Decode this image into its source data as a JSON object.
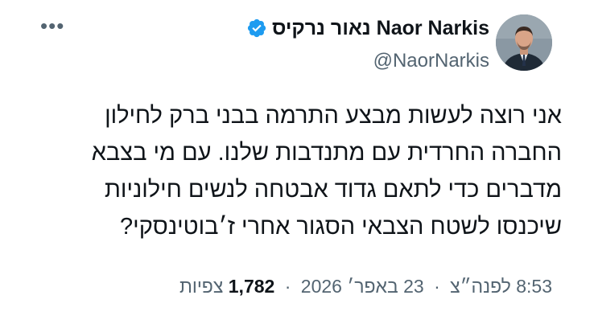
{
  "tweet": {
    "author": {
      "display_name": "Naor Narkis נאור נרקיס",
      "handle": "@NaorNarkis",
      "verified_icon": "verified-badge-icon",
      "avatar": "avatar"
    },
    "more_icon": "more-options-icon",
    "text_lines": [
      "אני רוצה לעשות מבצע התרמה בבני ברק לחילון",
      "החברה החרדית עם מתנדבות שלנו. עם מי בצבא",
      "מדברים כדי לתאם גדוד אבטחה לנשים חילוניות",
      "שיכנסו לשטח הצבאי הסגור אחרי ז׳בוטינסקי?"
    ],
    "meta": {
      "time": "8:53 לפנה״צ",
      "separator": "·",
      "date": "23 באפר׳ 2026",
      "views_count": "1,782",
      "views_label": "צפיות"
    },
    "colors": {
      "text": "#0f1419",
      "secondary": "#536471",
      "verified": "#1d9bf0"
    }
  }
}
